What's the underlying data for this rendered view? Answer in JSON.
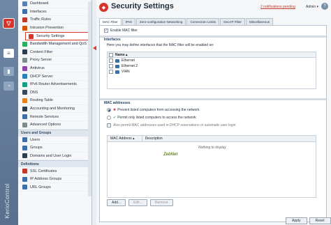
{
  "brand": "KerioControl",
  "sidebar": {
    "items": [
      {
        "label": "Dashboard",
        "color": "#5b7fb0"
      },
      {
        "label": "Interfaces",
        "color": "#3c6ea8"
      },
      {
        "label": "Traffic Rules",
        "color": "#c0392b"
      },
      {
        "label": "Intrusion Prevention",
        "color": "#d35400"
      },
      {
        "label": "Security Settings",
        "color": "#d8342b",
        "selected": true
      },
      {
        "label": "Bandwidth Management and QoS",
        "color": "#27ae60"
      },
      {
        "label": "Content Filter",
        "color": "#2c3e50"
      },
      {
        "label": "Proxy Server",
        "color": "#7f8c8d"
      },
      {
        "label": "Antivirus",
        "color": "#8e44ad"
      },
      {
        "label": "DHCP Server",
        "color": "#2980b9"
      },
      {
        "label": "IPv6 Router Advertisements",
        "color": "#16a085"
      },
      {
        "label": "DNS",
        "color": "#34495e"
      },
      {
        "label": "Routing Table",
        "color": "#e67e22"
      },
      {
        "label": "Accounting and Monitoring",
        "color": "#2c3e50"
      },
      {
        "label": "Remote Services",
        "color": "#3c6ea8"
      },
      {
        "label": "Advanced Options",
        "color": "#7f8c8d"
      }
    ],
    "section_users": "Users and Groups",
    "users_items": [
      {
        "label": "Users",
        "color": "#3c6ea8"
      },
      {
        "label": "Groups",
        "color": "#3c6ea8"
      },
      {
        "label": "Domains and User Login",
        "color": "#2c3e50"
      }
    ],
    "section_definitions": "Definitions",
    "definitions_items": [
      {
        "label": "SSL Certificates",
        "color": "#c0392b"
      },
      {
        "label": "IP Address Groups",
        "color": "#3c6ea8"
      },
      {
        "label": "URL Groups",
        "color": "#3c6ea8"
      }
    ]
  },
  "header": {
    "title": "Security Settings",
    "notifications": "2 notifications pending",
    "user": "Admin ▾"
  },
  "tabs": [
    "MAC Filter",
    "IPv6",
    "Zero-configuration Networking",
    "Connection Limits",
    "Geo-IP Filter",
    "Miscellaneous"
  ],
  "mac_filter": {
    "enable_label": "Enable MAC filter",
    "interfaces_title": "Interfaces",
    "interfaces_help": "Here you may define interfaces that the MAC filter will be enabled on:",
    "col_name": "Name ▴",
    "interfaces": [
      "Ethernet",
      "Ethernet 2",
      "VIAN"
    ],
    "mac_title": "MAC addresses",
    "option_prevent": "Prevent listed computers from accessing the network",
    "option_permit": "Permit only listed computers to access the network",
    "also_permit": "Also permit MAC addresses used in DHCP reservations or automatic user login",
    "col_mac": "MAC Address ▴",
    "col_desc": "Description",
    "empty_text": "Nothing to display",
    "watermark": "ZebNet",
    "add": "Add...",
    "edit": "Edit...",
    "remove": "Remove"
  },
  "footer": {
    "apply": "Apply",
    "reset": "Reset"
  }
}
